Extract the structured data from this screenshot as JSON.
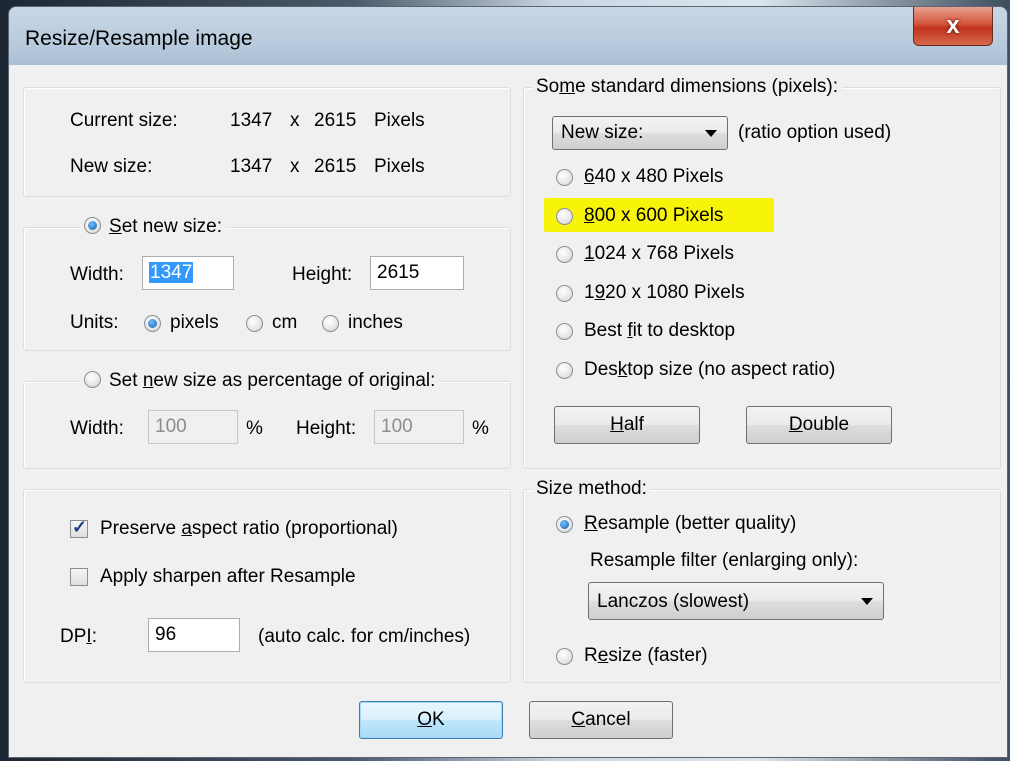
{
  "window": {
    "title": "Resize/Resample image",
    "close_glyph": "x"
  },
  "info": {
    "current_label": "Current size:",
    "current_w": "1347",
    "current_x": "x",
    "current_h": "2615",
    "current_unit": "Pixels",
    "new_label": "New size:",
    "new_w": "1347",
    "new_x": "x",
    "new_h": "2615",
    "new_unit": "Pixels"
  },
  "set_size": {
    "radio_s": "S",
    "radio_rest": "et new size:",
    "width_label": "Width:",
    "width_value": "1347",
    "height_label": "Height:",
    "height_value": "2615",
    "units_label": "Units:",
    "unit_pixels": "pixels",
    "unit_cm": "cm",
    "unit_inches": "inches"
  },
  "percent": {
    "radio_pre": "Set ",
    "radio_n": "n",
    "radio_post": "ew size as percentage of original:",
    "width_label": "Width:",
    "width_value": "100",
    "pct1": "%",
    "height_label": "Height:",
    "height_value": "100",
    "pct2": "%"
  },
  "options": {
    "preserve_pre": "Preserve ",
    "preserve_a": "a",
    "preserve_post": "spect ratio (proportional)",
    "sharpen_label": "Apply sharpen after Resample",
    "dpi_pre": "DP",
    "dpi_i": "I",
    "dpi_colon": ":",
    "dpi_value": "96",
    "dpi_note": "(auto calc. for cm/inches)"
  },
  "standard": {
    "legend_pre": "So",
    "legend_m": "m",
    "legend_post": "e standard dimensions (pixels):",
    "combo_value": "New size:",
    "ratio_note": "(ratio option used)",
    "opt1_u": "6",
    "opt1_rest": "40 x 480 Pixels",
    "opt2_u": "8",
    "opt2_rest": "00 x 600 Pixels",
    "opt3_u": "1",
    "opt3_rest": "024 x 768 Pixels",
    "opt4_pre": "1",
    "opt4_u": "9",
    "opt4_rest": "20 x 1080 Pixels",
    "opt5_pre": "Best ",
    "opt5_u": "f",
    "opt5_rest": "it to desktop",
    "opt6_pre": "Des",
    "opt6_u": "k",
    "opt6_rest": "top size (no aspect ratio)",
    "half_u": "H",
    "half_rest": "alf",
    "double_u": "D",
    "double_rest": "ouble",
    "highlight_color": "#f7f40a"
  },
  "method": {
    "legend": "Size method:",
    "resample_u": "R",
    "resample_rest": "esample (better quality)",
    "filter_label": "Resample filter (enlarging only):",
    "filter_value": "Lanczos (slowest)",
    "resize_pre": "R",
    "resize_u": "e",
    "resize_rest": "size (faster)"
  },
  "footer": {
    "ok_u": "O",
    "ok_rest": "K",
    "cancel_u": "C",
    "cancel_rest": "ancel"
  }
}
